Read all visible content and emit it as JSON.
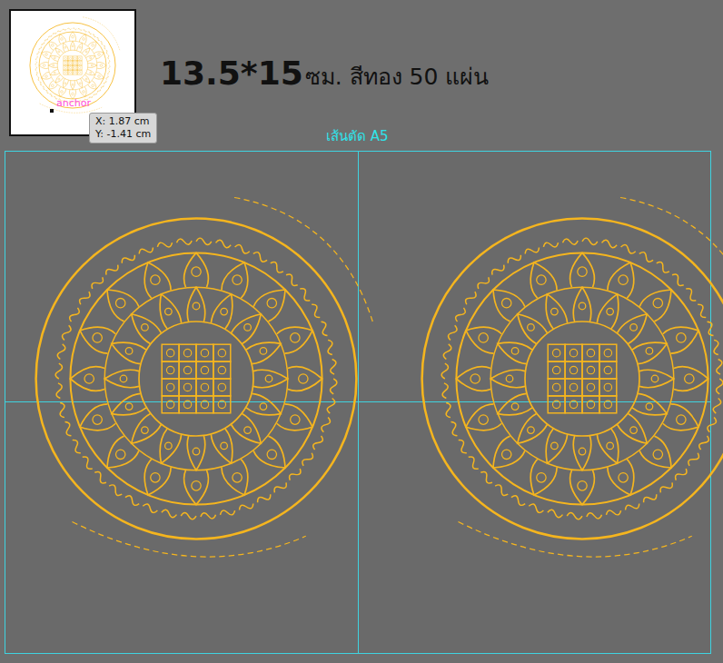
{
  "thumbnail": {
    "anchor_label": "anchor"
  },
  "tooltip": {
    "x": "X: 1.87 cm",
    "y": "Y: -1.41 cm"
  },
  "title": {
    "size": "13.5*15",
    "rest": "ซม. สีทอง 50 แผ่น"
  },
  "guide_label": "เส้นตัด A5"
}
